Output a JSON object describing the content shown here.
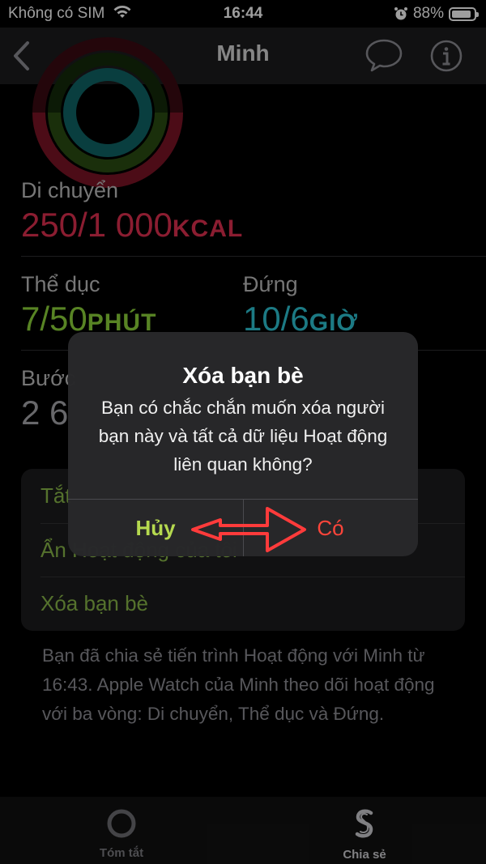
{
  "status_bar": {
    "carrier": "Không có SIM",
    "time": "16:44",
    "battery": "88%",
    "battery_level": 0.88
  },
  "nav": {
    "title": "Minh",
    "back_icon": "chevron-left-icon",
    "message_icon": "speech-bubble-icon",
    "info_icon": "info-circle-icon"
  },
  "stats": {
    "move": {
      "label": "Di chuyển",
      "value": "250/1 000",
      "unit": "KCAL",
      "color": "#e1304f"
    },
    "exercise": {
      "label": "Thể dục",
      "value": "7/50",
      "unit": "PHÚT",
      "color": "#8ed53a"
    },
    "stand": {
      "label": "Đứng",
      "value": "10/6",
      "unit": "GIỜ",
      "color": "#2ec6d6"
    },
    "steps": {
      "label": "Bước",
      "value": "2 6"
    }
  },
  "settings": {
    "row1": "Tắt",
    "row2": "Ẩn Hoạt động của tôi",
    "row3": "Xóa bạn bè"
  },
  "footer_note": "Bạn đã chia sẻ tiến trình Hoạt động với Minh từ 16:43. Apple Watch của Minh theo dõi hoạt động với ba vòng: Di chuyển, Thể dục và Đứng.",
  "alert": {
    "title": "Xóa bạn bè",
    "message": "Bạn có chắc chắn muốn xóa người bạn này và tất cả dữ liệu Hoạt động liên quan không?",
    "cancel": "Hủy",
    "confirm": "Có"
  },
  "tabbar": {
    "summary": "Tóm tắt",
    "sharing": "Chia sẻ"
  },
  "colors": {
    "accent_green": "#b5d94f",
    "destructive_red": "#ff453a",
    "annotation_arrow": "#ff3b3b"
  }
}
